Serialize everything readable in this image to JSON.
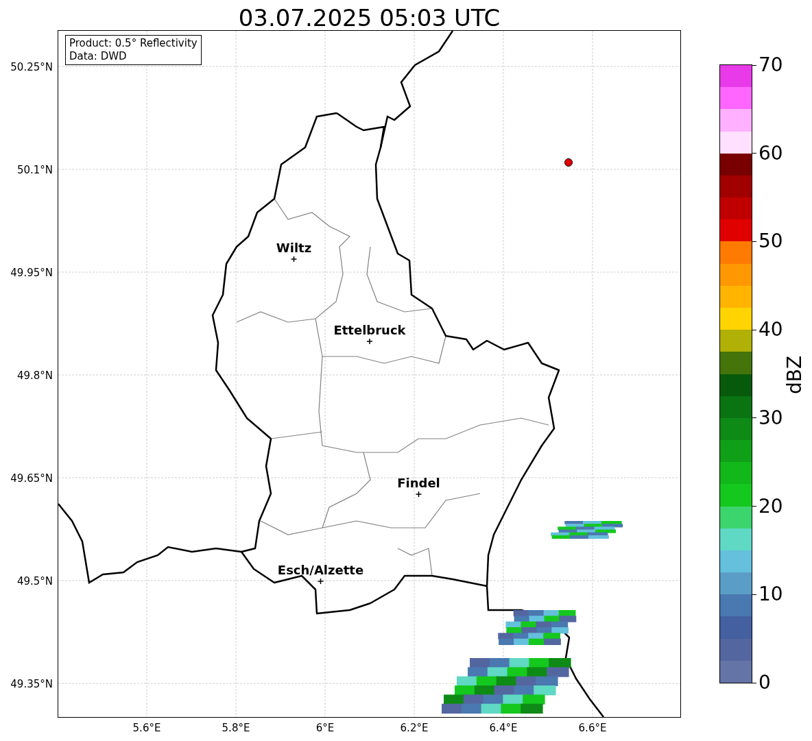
{
  "title": "03.07.2025 05:03 UTC",
  "info_box": {
    "lines": [
      "Product: 0.5° Reflectivity",
      "Data: DWD"
    ]
  },
  "map": {
    "yticks": [
      "50.25°N",
      "50.1°N",
      "49.95°N",
      "49.8°N",
      "49.65°N",
      "49.5°N",
      "49.35°N"
    ],
    "xticks": [
      "5.6°E",
      "5.8°E",
      "6°E",
      "6.2°E",
      "6.4°E",
      "6.6°E"
    ],
    "cities": [
      "Wiltz",
      "Ettelbruck",
      "Findel",
      "Esch/Alzette"
    ]
  },
  "colorbar": {
    "label": "dBZ",
    "ticks": [
      "70",
      "60",
      "50",
      "40",
      "30",
      "20",
      "10",
      "0"
    ],
    "bins": [
      {
        "color": "#e83ae8"
      },
      {
        "color": "#ff66ff"
      },
      {
        "color": "#ffb0ff"
      },
      {
        "color": "#ffe0ff"
      },
      {
        "color": "#780000"
      },
      {
        "color": "#a00000"
      },
      {
        "color": "#c00000"
      },
      {
        "color": "#e00000"
      },
      {
        "color": "#ff7a00"
      },
      {
        "color": "#ff9800"
      },
      {
        "color": "#ffb400"
      },
      {
        "color": "#ffd400"
      },
      {
        "color": "#b0b006"
      },
      {
        "color": "#44740a"
      },
      {
        "color": "#075a0c"
      },
      {
        "color": "#0a7412"
      },
      {
        "color": "#0e8a16"
      },
      {
        "color": "#10a018"
      },
      {
        "color": "#12b81a"
      },
      {
        "color": "#14c81e"
      },
      {
        "color": "#3cd46c"
      },
      {
        "color": "#5fd8c4"
      },
      {
        "color": "#64c0dc"
      },
      {
        "color": "#5a9ec8"
      },
      {
        "color": "#4a78b0"
      },
      {
        "color": "#4460a0"
      },
      {
        "color": "#5466a0"
      },
      {
        "color": "#6474a6"
      }
    ]
  }
}
